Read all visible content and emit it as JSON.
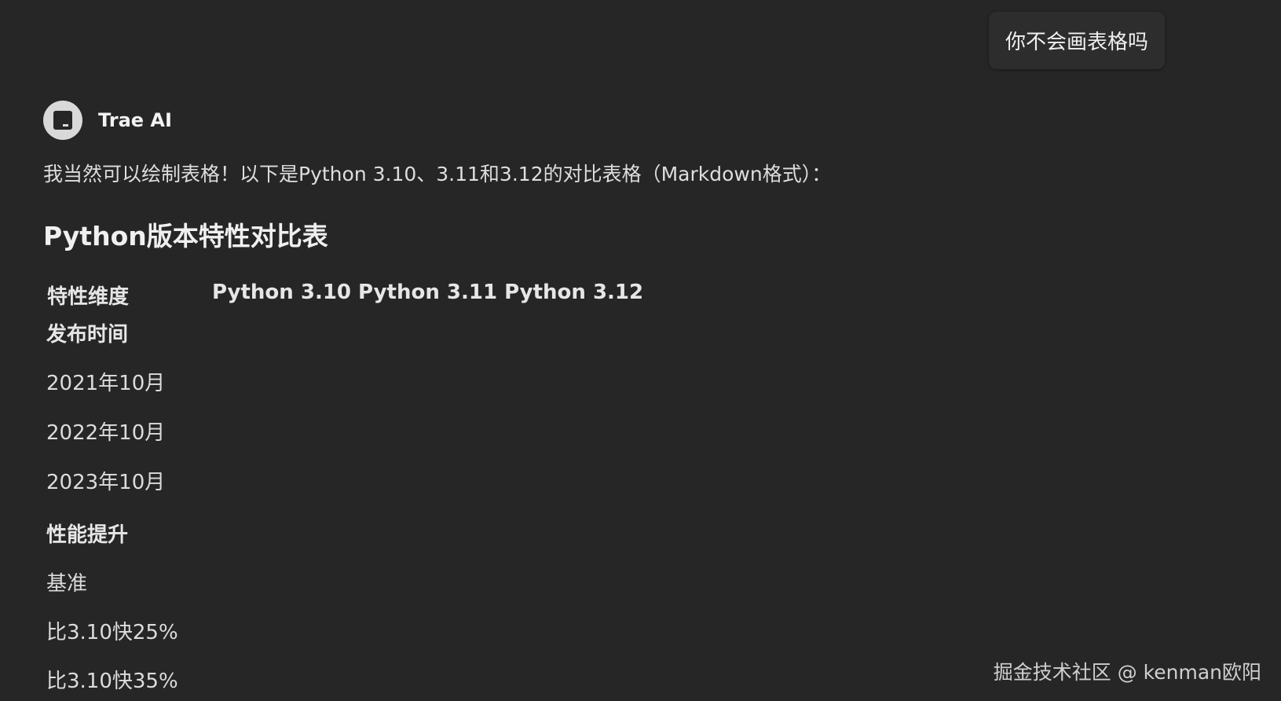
{
  "user_message": {
    "text": "你不会画表格吗"
  },
  "assistant": {
    "name": "Trae AI",
    "avatar_icon": "trae-logo-icon",
    "intro": "我当然可以绘制表格！以下是Python 3.10、3.11和3.12的对比表格（Markdown格式）：",
    "heading": "Python版本特性对比表"
  },
  "table": {
    "col_first": "特性维度",
    "col_rest": "Python 3.10 Python 3.11 Python 3.12",
    "rows": [
      {
        "text": "发布时间",
        "bold": true
      },
      {
        "text": "2021年10月",
        "bold": false
      },
      {
        "text": "2022年10月",
        "bold": false
      },
      {
        "text": "2023年10月",
        "bold": false
      },
      {
        "text": "性能提升",
        "bold": true
      },
      {
        "text": "基准",
        "bold": false
      },
      {
        "text": "比3.10快25%",
        "bold": false
      },
      {
        "text": "比3.10快35%",
        "bold": false
      }
    ]
  },
  "watermark": "掘金技术社区 @ kenman欧阳",
  "colors": {
    "background": "#262626",
    "text": "#e3e3e3",
    "bubble": "#2d2d2d"
  }
}
